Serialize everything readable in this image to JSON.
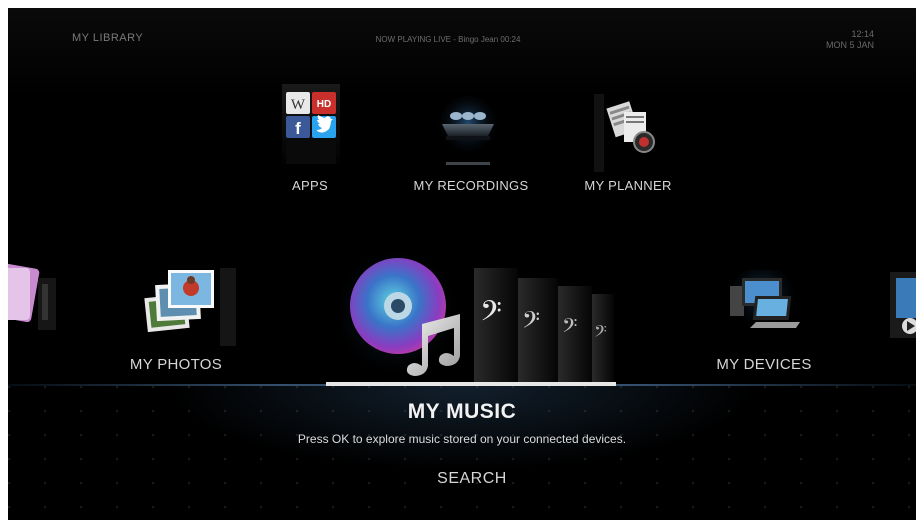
{
  "header": {
    "section": "MY LIBRARY",
    "now_playing": "NOW PLAYING LIVE - Bingo Jean 00:24",
    "time": "12:14",
    "date": "MON 5 JAN"
  },
  "top_row": [
    {
      "label": "APPS"
    },
    {
      "label": "MY RECORDINGS"
    },
    {
      "label": "MY PLANNER"
    }
  ],
  "carousel": {
    "left": {
      "label": "MY PHOTOS"
    },
    "right": {
      "label": "MY DEVICES"
    }
  },
  "selected": {
    "title": "MY MUSIC",
    "description": "Press OK to explore music stored on your connected devices.",
    "action": "SEARCH"
  },
  "colors": {
    "background": "#000000",
    "text": "#d6d6d6",
    "focus": "#e7e7e7",
    "accent_line": "#34506c"
  },
  "icons": [
    "apps-icon",
    "recordings-icon",
    "planner-icon",
    "photos-icon",
    "music-icon",
    "devices-icon",
    "wikipedia-icon",
    "facebook-icon",
    "twitter-icon",
    "hd-icon"
  ]
}
